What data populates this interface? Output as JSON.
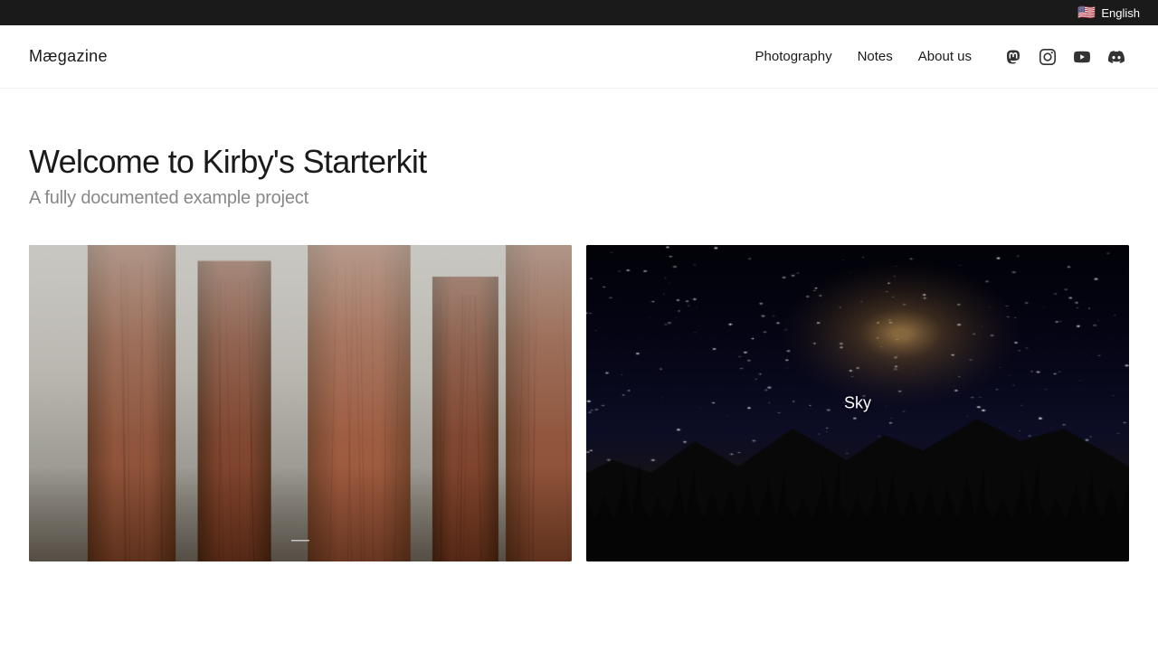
{
  "topbar": {
    "lang_label": "English"
  },
  "header": {
    "logo": "Mægazine",
    "nav": {
      "photography_label": "Photography",
      "notes_label": "Notes",
      "about_label": "About us"
    },
    "social": {
      "mastodon_title": "Mastodon",
      "instagram_title": "Instagram",
      "youtube_title": "YouTube",
      "discord_title": "Discord"
    }
  },
  "hero": {
    "title": "Welcome to Kirby's Starterkit",
    "subtitle": "A fully documented example project"
  },
  "gallery": {
    "items": [
      {
        "id": "forest",
        "label": "",
        "alt": "Forest with tall sequoia trees in misty fog"
      },
      {
        "id": "sky",
        "label": "Sky",
        "alt": "Milky Way galaxy over mountains at night"
      }
    ]
  }
}
